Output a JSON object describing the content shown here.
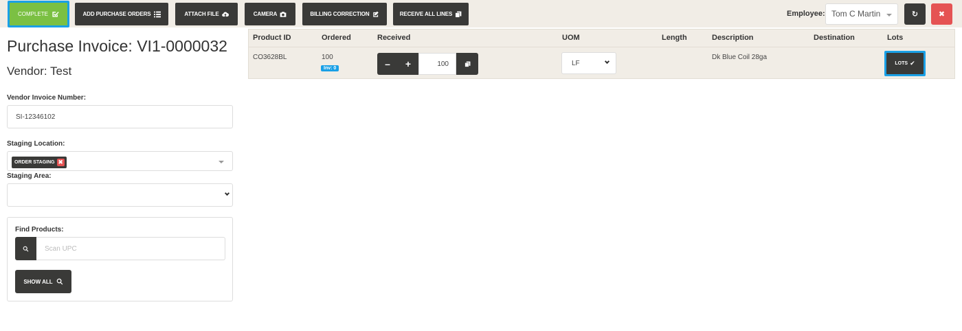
{
  "toolbar": {
    "complete": "COMPLETE",
    "add_purchase_orders": "ADD PURCHASE ORDERS",
    "attach_file": "ATTACH FILE",
    "camera": "CAMERA",
    "billing_correction": "BILLING CORRECTION",
    "receive_all_lines": "RECEIVE ALL LINES",
    "employee_label": "Employee:",
    "employee_value": "Tom C Martin"
  },
  "invoice": {
    "title": "Purchase Invoice: VI1-0000032",
    "vendor": "Vendor: Test"
  },
  "form": {
    "vendor_invoice_label": "Vendor Invoice Number:",
    "vendor_invoice_value": "SI-12346102",
    "staging_location_label": "Staging Location:",
    "staging_location_tag": "ORDER STAGING",
    "staging_area_label": "Staging Area:",
    "staging_area_value": ""
  },
  "find": {
    "label": "Find Products:",
    "placeholder": "Scan UPC",
    "show_all": "SHOW ALL"
  },
  "table": {
    "headers": {
      "product_id": "Product ID",
      "ordered": "Ordered",
      "received": "Received",
      "uom": "UOM",
      "length": "Length",
      "description": "Description",
      "destination": "Destination",
      "lots": "Lots"
    },
    "rows": [
      {
        "product_id": "CO3628BL",
        "ordered": "100",
        "inv_badge": "Inv: 0",
        "received": "100",
        "uom": "LF",
        "length": "",
        "description": "Dk Blue Coil 28ga",
        "destination": "",
        "lots_label": "LOTS"
      }
    ]
  },
  "colors": {
    "accent_blue": "#1aa0e6",
    "complete_green": "#7bc043",
    "dark_button": "#3a3a38",
    "danger_red": "#e55353"
  }
}
